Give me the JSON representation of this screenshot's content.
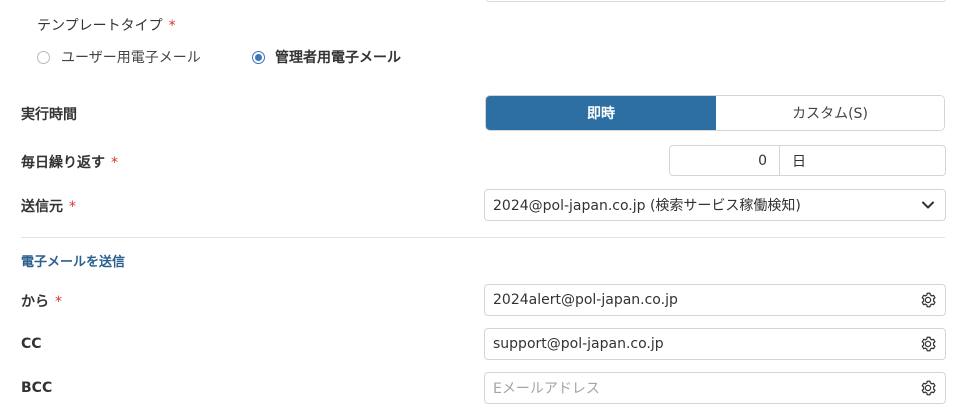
{
  "template_type": {
    "label": "テンプレートタイプ",
    "required_mark": "*",
    "options": [
      {
        "label": "ユーザー用電子メール",
        "checked": false
      },
      {
        "label": "管理者用電子メール",
        "checked": true
      }
    ]
  },
  "execution_time": {
    "label": "実行時間",
    "options": [
      "即時",
      "カスタム(S)"
    ],
    "selected": "即時"
  },
  "repeat_daily": {
    "label": "毎日繰り返す",
    "required_mark": "*",
    "value": "0",
    "unit": "日"
  },
  "sender": {
    "label": "送信元",
    "required_mark": "*",
    "value": "2024@pol-japan.co.jp (検索サービス稼働検知)"
  },
  "send_email_section": {
    "title": "電子メールを送信"
  },
  "from_field": {
    "label": "から",
    "required_mark": "*",
    "value": "2024alert@pol-japan.co.jp",
    "icon": "gear-icon"
  },
  "cc_field": {
    "label": "CC",
    "value": "support@pol-japan.co.jp",
    "icon": "gear-icon"
  },
  "bcc_field": {
    "label": "BCC",
    "value": "",
    "placeholder": "Eメールアドレス",
    "icon": "gear-icon"
  },
  "colors": {
    "accent": "#2e6fa3",
    "required": "#d9342b",
    "section_title": "#2a5f8f"
  }
}
